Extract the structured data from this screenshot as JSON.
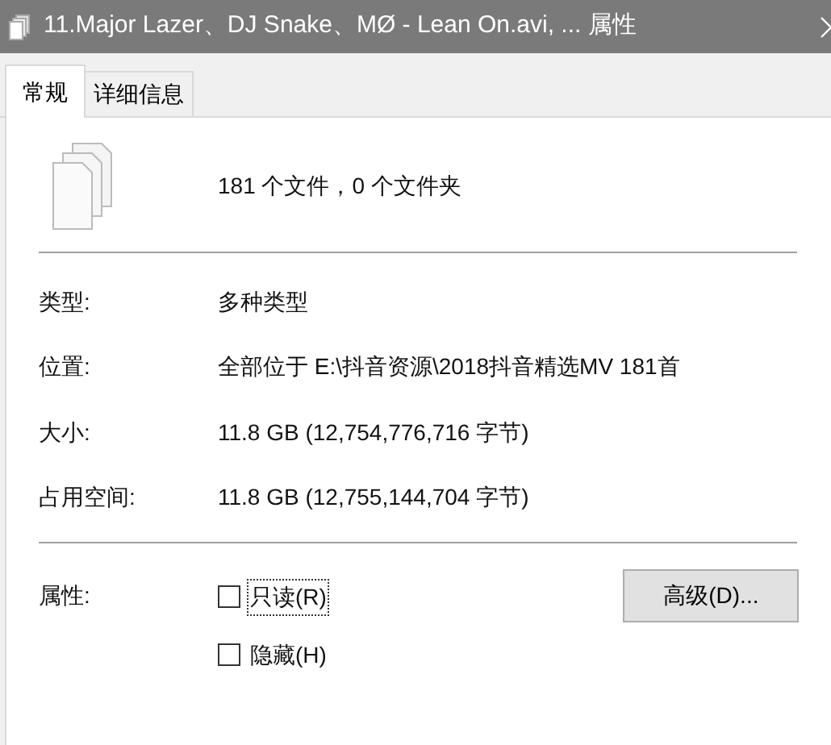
{
  "window": {
    "title": "11.Major Lazer、DJ Snake、MØ - Lean On.avi, ... 属性"
  },
  "tabs": [
    {
      "label": "常规",
      "selected": true
    },
    {
      "label": "详细信息",
      "selected": false
    }
  ],
  "summary": "181 个文件，0 个文件夹",
  "properties": [
    {
      "label": "类型:",
      "value": "多种类型"
    },
    {
      "label": "位置:",
      "value": "全部位于 E:\\抖音资源\\2018抖音精选MV 181首"
    },
    {
      "label": "大小:",
      "value": "11.8 GB (12,754,776,716 字节)"
    },
    {
      "label": "占用空间:",
      "value": "11.8 GB (12,755,144,704 字节)"
    }
  ],
  "attributes": {
    "label": "属性:",
    "checkboxes": [
      {
        "label": "只读(R)",
        "checked": false,
        "focused": true
      },
      {
        "label": "隐藏(H)",
        "checked": false,
        "focused": false
      }
    ],
    "button": "高级(D)..."
  }
}
